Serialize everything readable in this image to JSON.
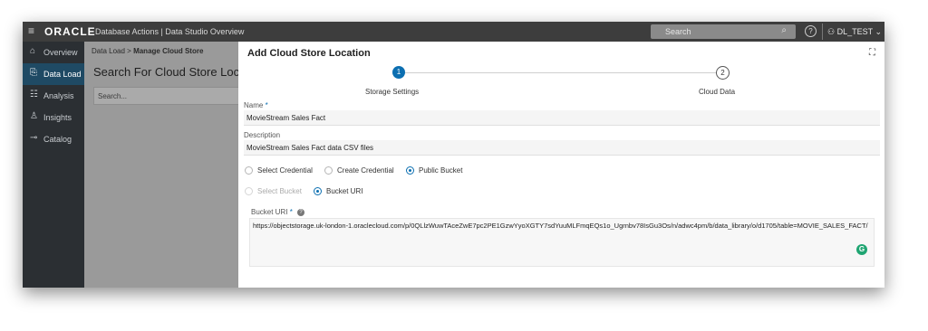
{
  "topbar": {
    "menu_icon": "hamburger-menu-icon",
    "logo": "ORACLE",
    "app_title": "Database Actions | Data Studio Overview",
    "search_placeholder": "Search",
    "search_icon": "search-icon",
    "help_icon": "help-icon",
    "user": "DL_TEST"
  },
  "sidebar": {
    "items": [
      {
        "label": "Overview",
        "icon": "home-icon",
        "active": false
      },
      {
        "label": "Data Load",
        "icon": "data-load-icon",
        "active": true
      },
      {
        "label": "Analysis",
        "icon": "analysis-icon",
        "active": false
      },
      {
        "label": "Insights",
        "icon": "insights-icon",
        "active": false
      },
      {
        "label": "Catalog",
        "icon": "catalog-icon",
        "active": false
      }
    ]
  },
  "background": {
    "breadcrumb_root": "Data Load",
    "breadcrumb_sep": ">",
    "breadcrumb_current": "Manage Cloud Store",
    "heading": "Search For Cloud Store Locat",
    "search_placeholder": "Search..."
  },
  "dialog": {
    "title": "Add Cloud Store Location",
    "expand_icon": "expand-icon",
    "steps": [
      {
        "number": "1",
        "label": "Storage Settings",
        "active": true
      },
      {
        "number": "2",
        "label": "Cloud Data",
        "active": false
      }
    ],
    "name_label": "Name",
    "required_mark": "*",
    "name_value": "MovieStream Sales Fact",
    "description_label": "Description",
    "description_value": "MovieStream Sales Fact data CSV files",
    "auth_options": [
      {
        "label": "Select Credential",
        "selected": false
      },
      {
        "label": "Create Credential",
        "selected": false
      },
      {
        "label": "Public Bucket",
        "selected": true
      }
    ],
    "bucket_options": [
      {
        "label": "Select Bucket",
        "selected": false,
        "disabled": true
      },
      {
        "label": "Bucket URI",
        "selected": true,
        "disabled": false
      }
    ],
    "bucket_uri_label": "Bucket URI",
    "bucket_uri_value": "https://objectstorage.uk-london-1.oraclecloud.com/p/0QLlzWuwTAceZwE7pc2PE1GzwYyoXGTY7sdYuuMLFmqEQs1o_Ugrnbv78IsGu3Os/n/adwc4pm/b/data_library/o/d1705/table=MOVIE_SALES_FACT/",
    "grammarly_icon": "grammarly-icon"
  },
  "colors": {
    "accent": "#0c6fb1",
    "sidebar_bg": "#2b2f33",
    "sidebar_active": "#1f4a64",
    "topbar_bg": "#3d3d3d"
  }
}
